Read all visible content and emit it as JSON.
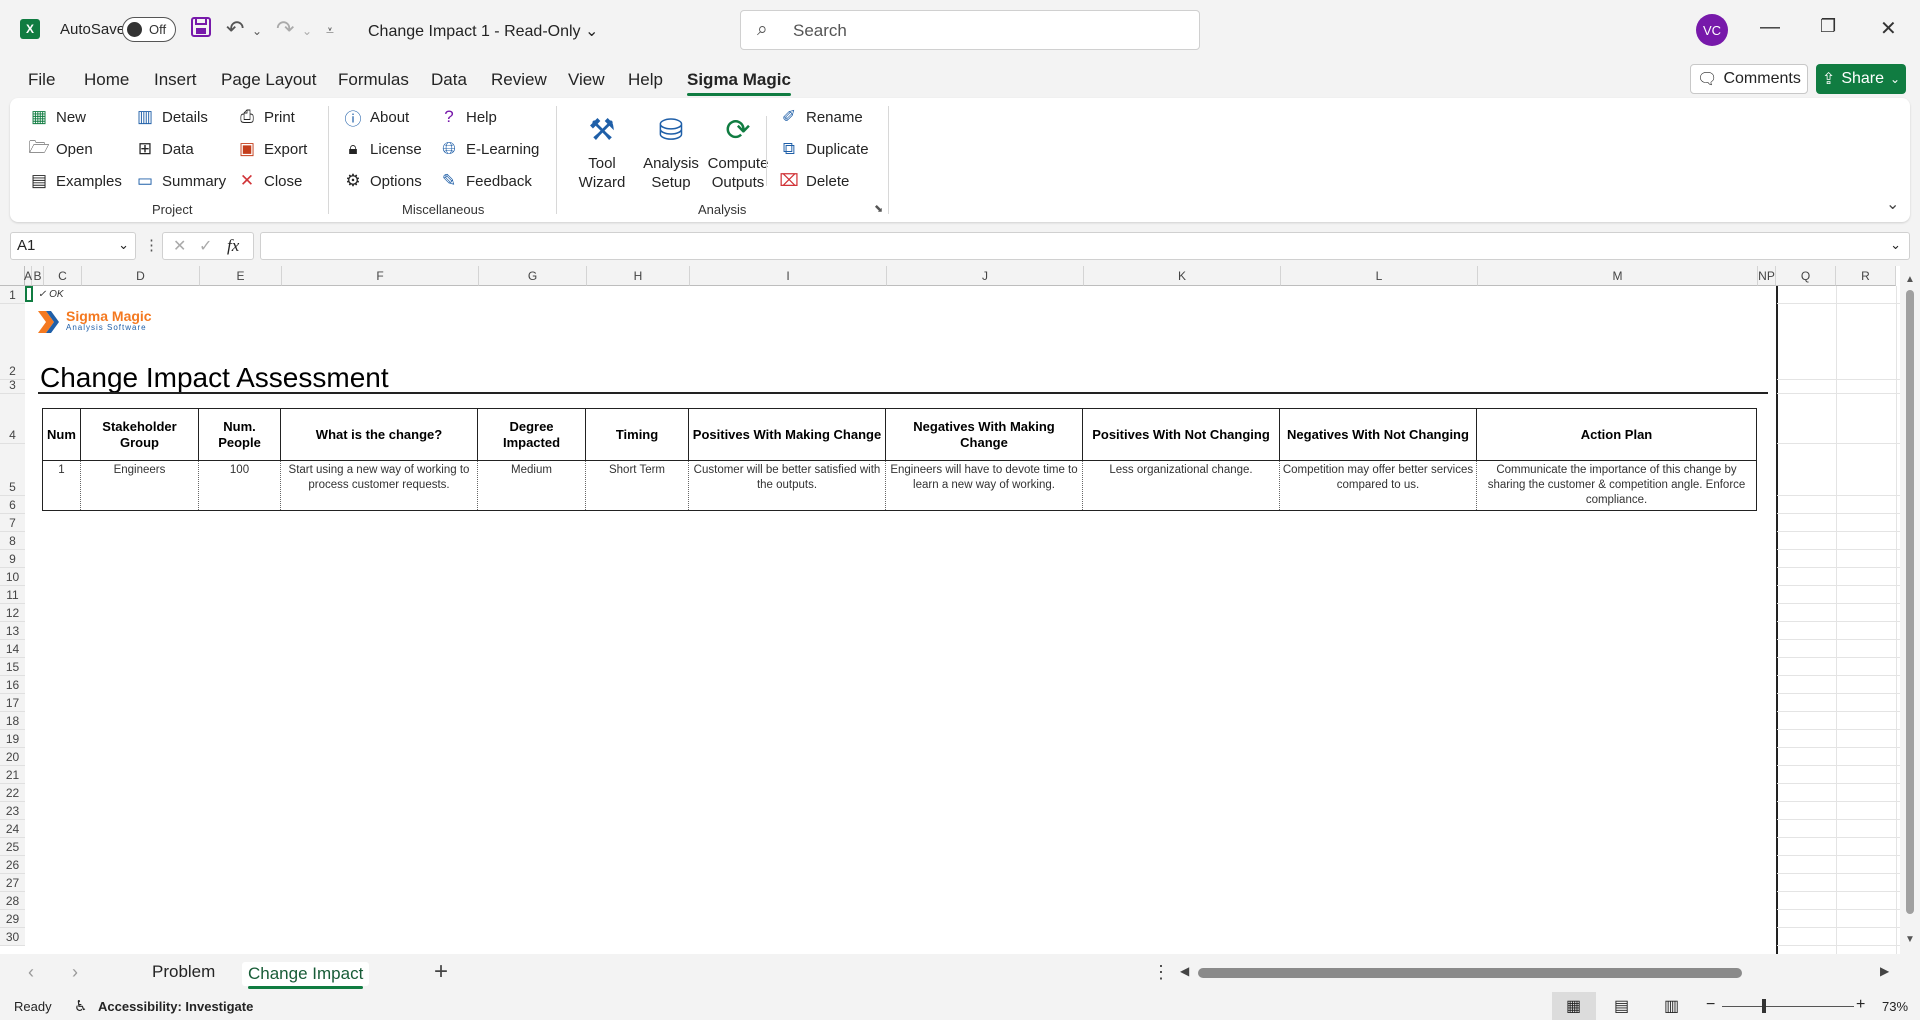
{
  "titlebar": {
    "autosave_label": "AutoSave",
    "autosave_state": "Off",
    "doc_title": "Change Impact 1  -  Read-Only",
    "search_placeholder": "Search",
    "avatar_initials": "VC"
  },
  "menu": {
    "tabs": [
      "File",
      "Home",
      "Insert",
      "Page Layout",
      "Formulas",
      "Data",
      "Review",
      "View",
      "Help",
      "Sigma Magic"
    ],
    "active_tab": "Sigma Magic",
    "comments_label": "Comments",
    "share_label": "Share"
  },
  "ribbon": {
    "project": {
      "label": "Project",
      "new": "New",
      "open": "Open",
      "examples": "Examples",
      "details": "Details",
      "data": "Data",
      "summary": "Summary",
      "print": "Print",
      "export": "Export",
      "close": "Close"
    },
    "misc": {
      "label": "Miscellaneous",
      "about": "About",
      "license": "License",
      "options": "Options",
      "help": "Help",
      "elearning": "E-Learning",
      "feedback": "Feedback"
    },
    "analysis": {
      "label": "Analysis",
      "tool_wizard_1": "Tool",
      "tool_wizard_2": "Wizard",
      "analysis_setup_1": "Analysis",
      "analysis_setup_2": "Setup",
      "compute_outputs_1": "Compute",
      "compute_outputs_2": "Outputs",
      "rename": "Rename",
      "duplicate": "Duplicate",
      "delete": "Delete"
    }
  },
  "formula_bar": {
    "name_box": "A1",
    "fx": "fx",
    "formula": ""
  },
  "grid": {
    "columns": [
      "A",
      "B",
      "C",
      "D",
      "E",
      "F",
      "G",
      "H",
      "I",
      "J",
      "K",
      "L",
      "M",
      "NP",
      "Q",
      "R"
    ],
    "rows": [
      "1",
      "2",
      "3",
      "4",
      "5",
      "6",
      "7",
      "8",
      "9",
      "10",
      "11",
      "12",
      "13",
      "14",
      "15",
      "16",
      "17",
      "18",
      "19",
      "20",
      "21",
      "22",
      "23",
      "24",
      "25",
      "26",
      "27",
      "28",
      "29",
      "30"
    ],
    "ok_marker": "✓ OK",
    "logo_name": "Sigma Magic",
    "logo_sub": "Analysis Software",
    "sheet_title": "Change Impact Assessment"
  },
  "table": {
    "headers": [
      "Num",
      "Stakeholder Group",
      "Num. People",
      "What is the change?",
      "Degree Impacted",
      "Timing",
      "Positives With Making Change",
      "Negatives With Making Change",
      "Positives With Not Changing",
      "Negatives With Not Changing",
      "Action Plan"
    ],
    "rows": [
      [
        "1",
        "Engineers",
        "100",
        "Start using a new way of working to process customer requests.",
        "Medium",
        "Short Term",
        "Customer will be better satisfied with the outputs.",
        "Engineers will have to devote time to learn a new way of working.",
        "Less organizational change.",
        "Competition may offer better services compared to us.",
        "Communicate the importance of this change by sharing the customer & competition angle. Enforce compliance."
      ]
    ]
  },
  "sheet_tabs": {
    "tabs": [
      "Problem",
      "Change Impact"
    ],
    "active": "Change Impact"
  },
  "status": {
    "ready": "Ready",
    "accessibility": "Accessibility: Investigate",
    "zoom": "73%"
  },
  "colors": {
    "excel_green": "#107c41",
    "avatar_purple": "#7719aa",
    "logo_orange": "#f47920",
    "logo_blue": "#1f5fa8"
  }
}
